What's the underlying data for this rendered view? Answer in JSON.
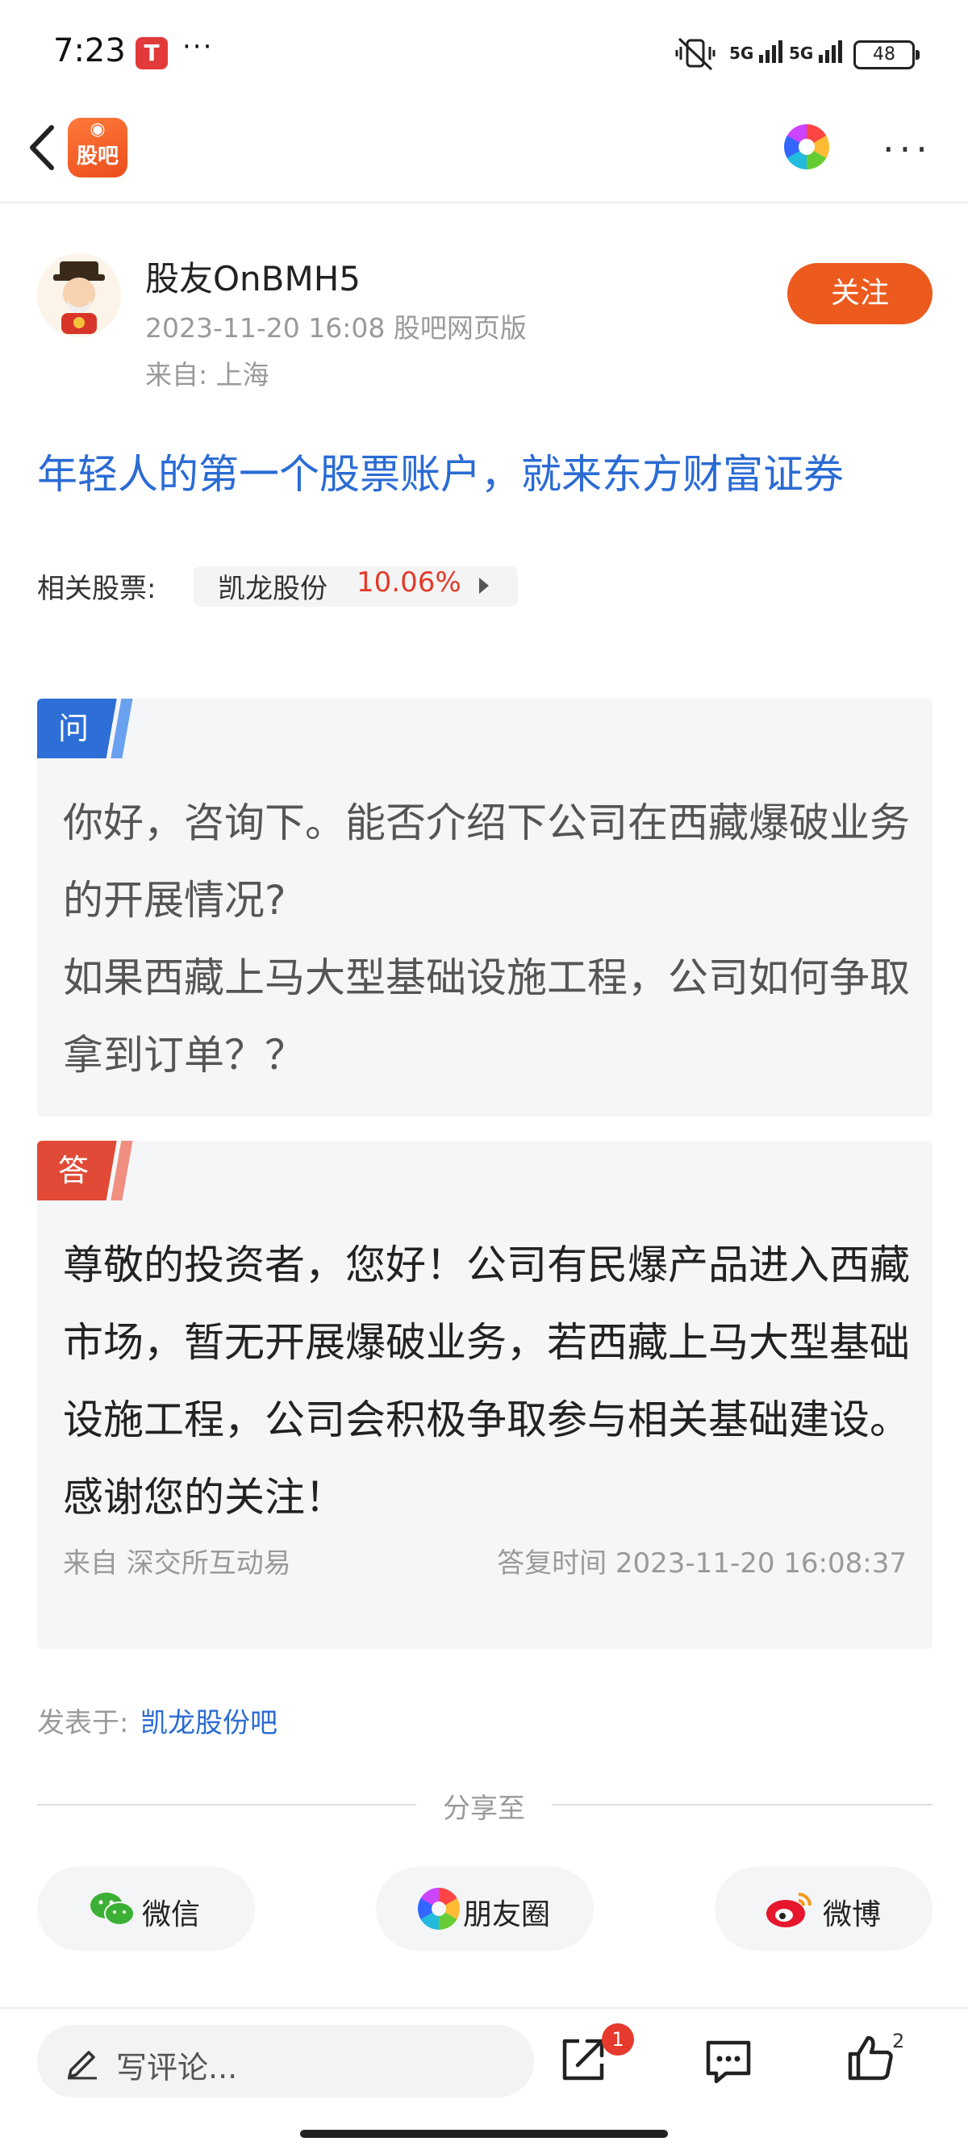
{
  "status_bar": {
    "time": "7:23",
    "more": "···",
    "net1": "5G",
    "net2": "5G",
    "battery": "48"
  },
  "header": {
    "logo_text": "股吧",
    "more": "···"
  },
  "author": {
    "name": "股友OnBMH5",
    "datetime": "2023-11-20 16:08 股吧网页版",
    "location": "来自: 上海",
    "follow_label": "关注"
  },
  "ad_title": "年轻人的第一个股票账户，就来东方财富证券",
  "related": {
    "label": "相关股票:",
    "stock": "凯龙股份",
    "change": "10.06%"
  },
  "question": {
    "tag": "问",
    "text_line1": "你好，咨询下。能否介绍下公司在西藏爆破业务的开展情况?",
    "text_line2": "如果西藏上马大型基础设施工程，公司如何争取拿到订单？？"
  },
  "answer": {
    "tag": "答",
    "text": "尊敬的投资者，您好！公司有民爆产品进入西藏市场，暂无开展爆破业务，若西藏上马大型基础设施工程，公司会积极争取参与相关基础建设。感谢您的关注！",
    "source": "来自 深交所互动易",
    "reply_time": "答复时间 2023-11-20 16:08:37"
  },
  "posted": {
    "label": "发表于:",
    "bar": "凯龙股份吧"
  },
  "share": {
    "label": "分享至",
    "wechat": "微信",
    "moments": "朋友圈",
    "weibo": "微博"
  },
  "bottom_bar": {
    "comment_placeholder": "写评论...",
    "share_badge": "1",
    "like_count": "2"
  },
  "colors": {
    "accent_orange": "#ec5a1e",
    "link_blue": "#2a6bd4",
    "red": "#e33a2a",
    "q_blue": "#2d6fd6",
    "a_red": "#e04a36"
  }
}
